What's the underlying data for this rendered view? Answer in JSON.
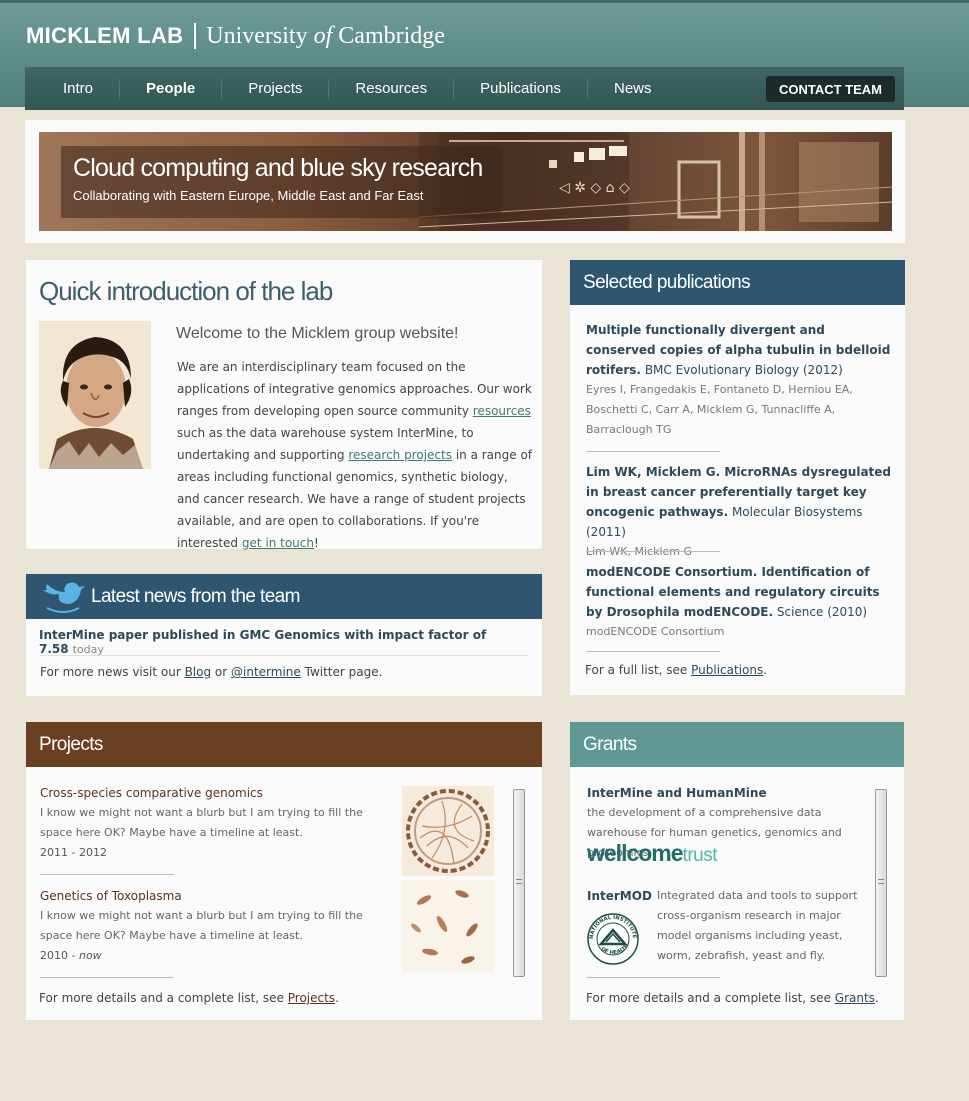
{
  "brand": {
    "lab": "MICKLEM LAB",
    "university_pre": "University ",
    "university_of": "of",
    "university_post": " Cambridge"
  },
  "nav": {
    "items": [
      "Intro",
      "People",
      "Projects",
      "Resources",
      "Publications",
      "News"
    ],
    "active": "People",
    "contact": "CONTACT TEAM"
  },
  "banner": {
    "title": "Cloud computing and blue sky research",
    "subtitle": "Collaborating with Eastern Europe, Middle East and Far East"
  },
  "intro": {
    "title": "Quick introduction of the lab",
    "welcome": "Welcome to the Micklem group website!",
    "text1": "We are an interdisciplinary team focused on the applications of integrative genomics approaches. Our work ranges from developing open source community ",
    "link_resources": "resources",
    "text2": " such as the data warehouse system InterMine, to undertaking and supporting ",
    "link_projects": "research projects",
    "text3": " in a range of areas including functional genomics, synthetic biology, and cancer research. We have a range of student projects available, and are open to collaborations. If you're interested ",
    "link_touch": "get in touch",
    "text4": "!"
  },
  "news": {
    "title": "Latest news from the team",
    "item": "InterMine paper published in GMC Genomics with impact factor of 7.58",
    "item_when": "today",
    "more_pre": "For more news visit our ",
    "blog": "Blog",
    "more_or": " or ",
    "twitter": "@intermine",
    "more_post": " Twitter page."
  },
  "publications": {
    "title": "Selected publications",
    "items": [
      {
        "title": "Multiple functionally divergent and conserved copies of alpha tubulin in bdelloid rotifers.",
        "journal": "BMC Evolutionary Biology (2012)",
        "authors": "Eyres I, Frangedakis E, Fontaneto D, Herniou EA, Boschetti C, Carr A, Micklem G, Tunnacliffe A, Barraclough TG"
      },
      {
        "title": "Lim WK, Micklem G. MicroRNAs dysregulated in breast cancer preferentially target key oncogenic pathways.",
        "journal": "Molecular Biosystems (2011)",
        "authors": "Lim WK, Micklem G"
      },
      {
        "title": "modENCODE Consortium. Identification of functional elements and regulatory circuits by Drosophila modENCODE.",
        "journal": "Science (2010)",
        "authors": "modENCODE Consortium"
      }
    ],
    "more_pre": "For a full list, see ",
    "more_link": "Publications",
    "more_post": "."
  },
  "projects": {
    "title": "Projects",
    "items": [
      {
        "title": "Cross-species comparative genomics",
        "desc": "I know we might not want a blurb but I am trying to fill the space here OK? Maybe have a timeline at least.",
        "years": "2011 - 2012",
        "years_end": ""
      },
      {
        "title": "Genetics of Toxoplasma",
        "desc": "I know we might not want a blurb but I am trying to fill the space here OK? Maybe have a timeline at least.",
        "years": "2010 - ",
        "years_end": "now"
      }
    ],
    "more_pre": "For more details and a complete list, see ",
    "more_link": "Projects",
    "more_post": "."
  },
  "grants": {
    "title": "Grants",
    "items": [
      {
        "title": "InterMine and HumanMine",
        "desc": "the development of a comprehensive data warehouse for human genetics, genomics and proteomics."
      },
      {
        "title": "InterMOD",
        "desc": "Integrated data and tools to support cross-organism research in major model organisms including yeast, worm, zebrafish, yeast and fly."
      }
    ],
    "wellcome_bold": "wellcome",
    "wellcome_light": "trust",
    "nih_top": "NATIONAL INSTITUTES",
    "nih_bottom": "OF HEALTH",
    "more_pre": "For more details and a complete list, see ",
    "more_link": "Grants",
    "more_post": "."
  },
  "colors": {
    "header": "#5f8f8a",
    "nav": "#3a605c",
    "news_head": "#2e5670",
    "projects_head": "#6b3f21",
    "grants_head": "#5e9a93",
    "background": "#e9e4d6"
  }
}
